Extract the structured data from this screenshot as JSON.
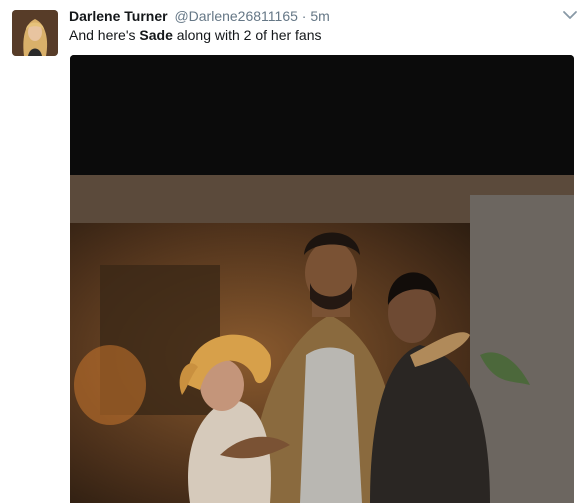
{
  "tweet": {
    "author_name": "Darlene Turner",
    "handle": "@Darlene26811165",
    "separator": "·",
    "timestamp": "5m",
    "text_before": "And here's ",
    "text_bold": "Sade",
    "text_after": " along with 2 of her fans",
    "caret_icon": "chevron-down-icon",
    "media_type": "photo"
  },
  "colors": {
    "name": "#14171a",
    "meta": "#657786",
    "photo_background": "#0a0a0a"
  }
}
